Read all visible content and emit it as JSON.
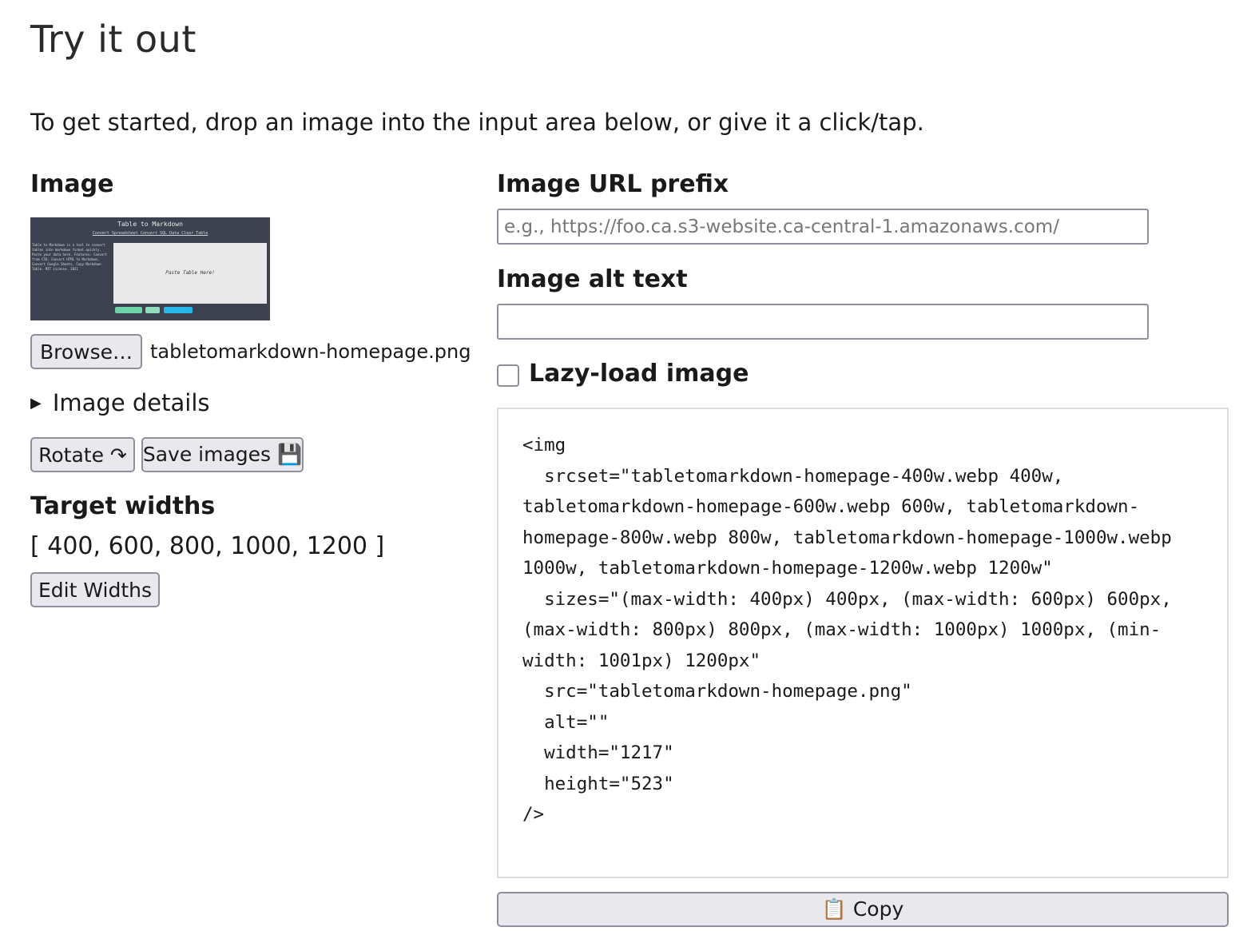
{
  "heading": "Try it out",
  "intro": "To get started, drop an image into the input area below, or give it a click/tap.",
  "image_section": {
    "label": "Image",
    "preview": {
      "title": "Table to Markdown",
      "nav_links": "Convert Spreadsheet   Convert SQL Data   Clear Table",
      "side_text": "Table to Markdown is a tool to convert tables into markdown format quickly. Paste your data here. Features: Convert from CSV, Convert HTML to Markdown, Convert Google Sheets, Copy Markdown Table. MIT License. 2021",
      "paste_text": "Paste Table Here!"
    },
    "browse_label": "Browse…",
    "filename": "tabletomarkdown-homepage.png",
    "details_label": "Image details",
    "rotate_label": "Rotate ↷",
    "save_label": "Save images 💾"
  },
  "target_widths": {
    "label": "Target widths",
    "value": "[ 400, 600, 800, 1000, 1200 ]",
    "edit_label": "Edit Widths"
  },
  "url_prefix": {
    "label": "Image URL prefix",
    "placeholder": "e.g., https://foo.ca.s3-website.ca-central-1.amazonaws.com/",
    "value": ""
  },
  "alt_text": {
    "label": "Image alt text",
    "value": ""
  },
  "lazy_load": {
    "label": "Lazy-load image",
    "checked": false
  },
  "output_code": "<img\n  srcset=\"tabletomarkdown-homepage-400w.webp 400w, tabletomarkdown-homepage-600w.webp 600w, tabletomarkdown-homepage-800w.webp 800w, tabletomarkdown-homepage-1000w.webp 1000w, tabletomarkdown-homepage-1200w.webp 1200w\"\n  sizes=\"(max-width: 400px) 400px, (max-width: 600px) 600px, (max-width: 800px) 800px, (max-width: 1000px) 1000px, (min-width: 1001px) 1200px\"\n  src=\"tabletomarkdown-homepage.png\"\n  alt=\"\"\n  width=\"1217\"\n  height=\"523\"\n/>",
  "copy_label": "📋 Copy",
  "colors": {
    "button_bg": "#e9e9ed",
    "button_border": "#8f8f9d",
    "preview_dark": "#3d4250",
    "preview_accent_green": "#6fd3a8",
    "preview_accent_blue": "#29b6e8"
  }
}
